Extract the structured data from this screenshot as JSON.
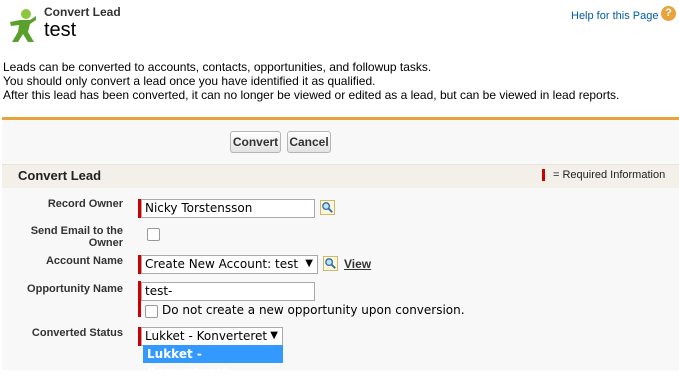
{
  "header": {
    "subtitle": "Convert Lead",
    "title": "test",
    "help_link": "Help for this Page",
    "help_icon": "?"
  },
  "intro": {
    "lines": [
      "Leads can be converted to accounts, contacts, opportunities, and followup tasks.",
      "You should only convert a lead once you have identified it as qualified.",
      "After this lead has been converted, it can no longer be viewed or edited as a lead, but can be viewed in lead reports."
    ]
  },
  "buttons": {
    "convert": "Convert",
    "cancel": "Cancel"
  },
  "section": {
    "title": "Convert Lead",
    "required_text": "= Required Information"
  },
  "form": {
    "record_owner": {
      "label": "Record Owner",
      "value": "Nicky Torstensson"
    },
    "send_email": {
      "label_line1": "Send Email to the",
      "label_line2": "Owner",
      "checked": false
    },
    "account_name": {
      "label": "Account Name",
      "value": "Create New Account: test",
      "view_link": "View"
    },
    "opportunity_name": {
      "label": "Opportunity Name",
      "value": "test-",
      "no_opp_label": "Do not create a new opportunity upon conversion.",
      "no_opp_checked": false
    },
    "converted_status": {
      "label": "Converted Status",
      "value": "Lukket - Konverteret",
      "options": [
        "Lukket - Konverteret"
      ]
    }
  },
  "colors": {
    "accent": "#e8a33a",
    "required": "#cc0000",
    "link": "#015ba7",
    "highlight": "#3399ff"
  }
}
